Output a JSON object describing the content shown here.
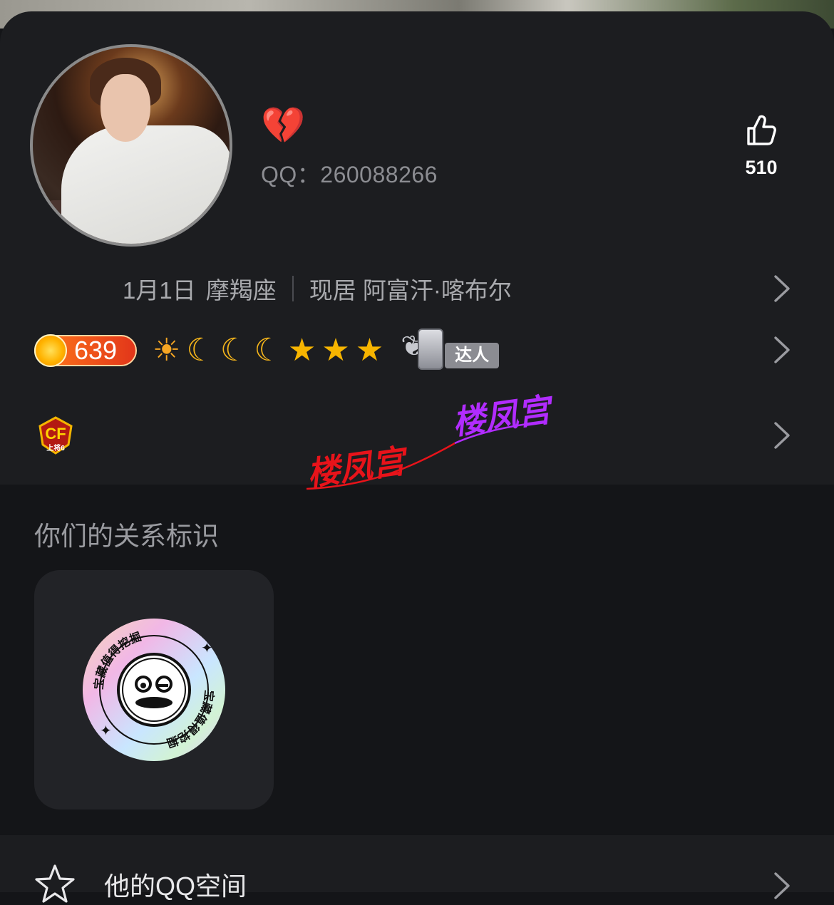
{
  "profile": {
    "nickname_emoji": "💔",
    "qq_label": "QQ：260088266",
    "likes": "510"
  },
  "info": {
    "birthday": "1月1日",
    "zodiac": "摩羯座",
    "location": "现居 阿富汗·喀布尔"
  },
  "level": {
    "value": "639",
    "icons": [
      "sun",
      "moon",
      "moon",
      "moon",
      "star",
      "star",
      "star"
    ],
    "talent_label": "达人"
  },
  "game_badge": {
    "name": "cf-rank-badge",
    "text": "上将6"
  },
  "watermark": {
    "text1": "楼凤宫",
    "text2": "楼凤宫"
  },
  "relation": {
    "title": "你们的关系标识",
    "medal_text": "宝藏值得挖掘"
  },
  "qzone": {
    "label": "他的QQ空间"
  },
  "colors": {
    "background": "#141518",
    "card": "#1c1d20",
    "muted_text": "#8c8d92",
    "level_badge": "#e2361a",
    "watermark_red": "#e8131a",
    "watermark_purple": "#b12cff"
  }
}
